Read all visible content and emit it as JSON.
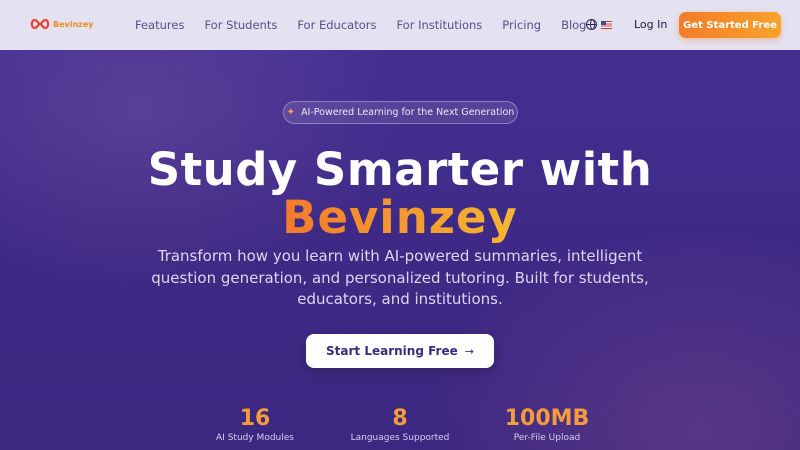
{
  "nav": {
    "logo_text": "Bevinzey",
    "links": [
      "Features",
      "For Students",
      "For Educators",
      "For Institutions",
      "Pricing",
      "Blog"
    ],
    "login": "Log In",
    "cta": "Get Started Free",
    "language_icon": "globe-icon",
    "flag_icon": "us-flag-icon"
  },
  "hero": {
    "badge_icon": "sparkles-icon",
    "badge": "AI-Powered Learning for the Next Generation",
    "title_line1": "Study Smarter with",
    "title_line2": "Bevinzey",
    "subtitle": "Transform how you learn with AI-powered summaries, intelligent question generation, and personalized tutoring. Built for students, educators, and institutions.",
    "cta": "Start Learning Free",
    "cta_icon": "arrow-right-icon"
  },
  "stats": [
    {
      "value": "16",
      "label": "AI Study Modules"
    },
    {
      "value": "8",
      "label": "Languages Supported"
    },
    {
      "value": "100MB",
      "label": "Per-File Upload"
    }
  ],
  "colors": {
    "accent": "#f47c2a",
    "accent_light": "#f7a32b",
    "hero_bg": "#3f2a86",
    "nav_bg": "#e4e1f0"
  }
}
